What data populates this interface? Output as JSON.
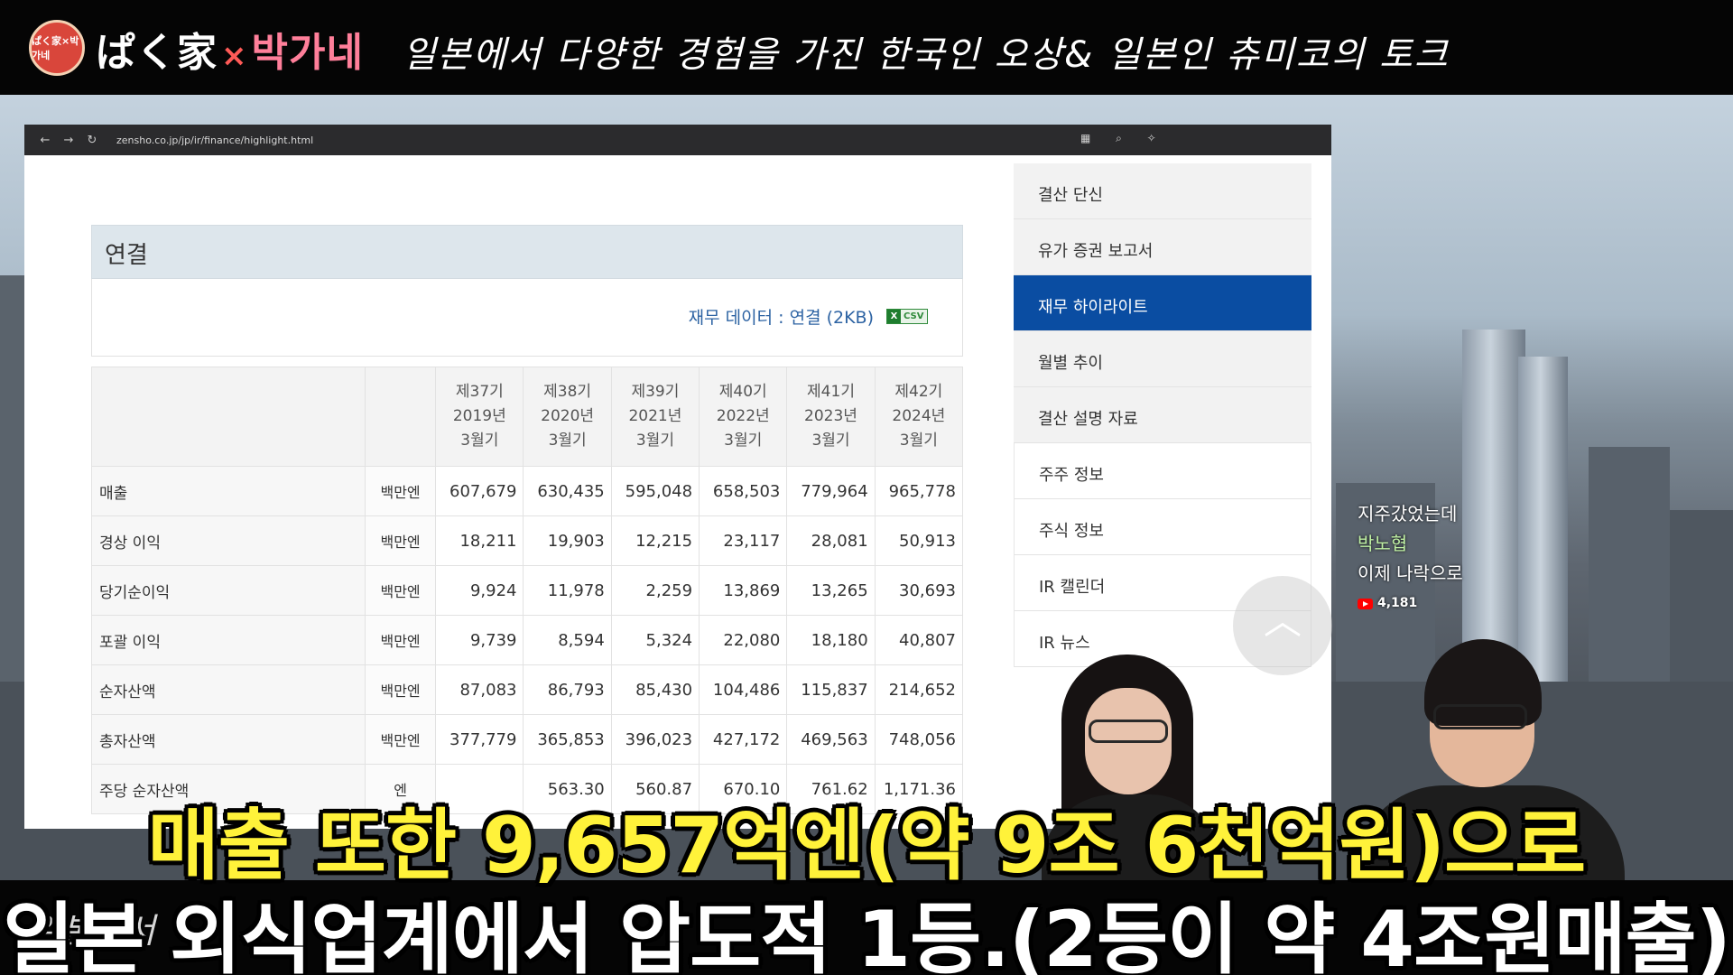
{
  "banner": {
    "logo_text": "ぱく家×박가네",
    "brand_left": "ぱく家",
    "brand_x": "×",
    "brand_right": "박가네",
    "title": "일본에서 다양한 경험을 가진 한국인 오상& 일본인 츄미코의 토크"
  },
  "browser": {
    "url": "zensho.co.jp/jp/ir/finance/highlight.html",
    "nav": {
      "back": "←",
      "forward": "→",
      "reload": "↻"
    }
  },
  "section": {
    "title": "연결",
    "csv_link": "재무 데이터 : 연결 (2KB)",
    "csv_icon_label": "CSV",
    "csv_icon_x": "X"
  },
  "table": {
    "headers": [
      {
        "period": "제37기",
        "year": "2019년",
        "month": "3월기"
      },
      {
        "period": "제38기",
        "year": "2020년",
        "month": "3월기"
      },
      {
        "period": "제39기",
        "year": "2021년",
        "month": "3월기"
      },
      {
        "period": "제40기",
        "year": "2022년",
        "month": "3월기"
      },
      {
        "period": "제41기",
        "year": "2023년",
        "month": "3월기"
      },
      {
        "period": "제42기",
        "year": "2024년",
        "month": "3월기"
      }
    ],
    "rows": [
      {
        "label": "매출",
        "unit": "백만엔",
        "values": [
          "607,679",
          "630,435",
          "595,048",
          "658,503",
          "779,964",
          "965,778"
        ]
      },
      {
        "label": "경상 이익",
        "unit": "백만엔",
        "values": [
          "18,211",
          "19,903",
          "12,215",
          "23,117",
          "28,081",
          "50,913"
        ]
      },
      {
        "label": "당기순이익",
        "unit": "백만엔",
        "values": [
          "9,924",
          "11,978",
          "2,259",
          "13,869",
          "13,265",
          "30,693"
        ]
      },
      {
        "label": "포괄 이익",
        "unit": "백만엔",
        "values": [
          "9,739",
          "8,594",
          "5,324",
          "22,080",
          "18,180",
          "40,807"
        ]
      },
      {
        "label": "순자산액",
        "unit": "백만엔",
        "values": [
          "87,083",
          "86,793",
          "85,430",
          "104,486",
          "115,837",
          "214,652"
        ]
      },
      {
        "label": "총자산액",
        "unit": "백만엔",
        "values": [
          "377,779",
          "365,853",
          "396,023",
          "427,172",
          "469,563",
          "748,056"
        ]
      },
      {
        "label": "주당 순자산액",
        "unit": "엔",
        "values": [
          "",
          "563.30",
          "560.87",
          "670.10",
          "761.62",
          "1,171.36"
        ]
      }
    ]
  },
  "sidebar": {
    "items": [
      {
        "label": "결산 단신"
      },
      {
        "label": "유가 증권 보고서"
      },
      {
        "label": "재무 하이라이트"
      },
      {
        "label": "월별 추이"
      },
      {
        "label": "결산 설명 자료"
      },
      {
        "label": "주주 정보"
      },
      {
        "label": "주식 정보"
      },
      {
        "label": "IR 캘린더"
      },
      {
        "label": "IR 뉴스"
      }
    ],
    "active_index": 2
  },
  "scroll_top_icon": "chevron-up-icon",
  "chat": {
    "line1": "지주갔었는데",
    "username": "박노협",
    "line2": "이제 나락으로",
    "views": "4,181"
  },
  "bottom": {
    "faded_text": "일본에서"
  },
  "caption": {
    "line1": "매출 또한 9,657억엔(약 9조 6천억원)으로",
    "line2": "일본 외식업계에서 압도적 1등.(2등이 약 4조원매출)"
  },
  "colors": {
    "caption_line1": "#fff23a",
    "active_menu": "#0a4da2",
    "link": "#2d63a3"
  }
}
